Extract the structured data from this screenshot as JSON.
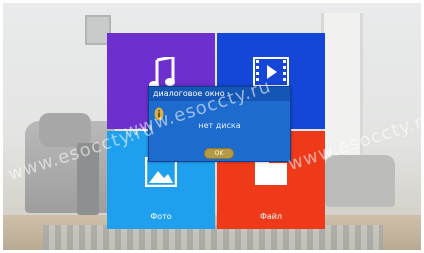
{
  "tiles": {
    "music": {
      "icon": "music-note-icon",
      "color": "#6e2fcf"
    },
    "video": {
      "icon": "film-icon",
      "color": "#1447d8"
    },
    "photo": {
      "icon": "image-icon",
      "label": "Фото",
      "color": "#1ea0ee"
    },
    "file": {
      "icon": "folder-icon",
      "label": "Файл",
      "color": "#ee3a19"
    }
  },
  "dialog": {
    "title": "диалоговое окно",
    "message": "нет диска",
    "ok_label": "OK",
    "icon": "info-icon"
  },
  "watermarks": [
    "www.esoccty.ru",
    "www.esoccty.ru",
    "www.esoccty.ru"
  ]
}
